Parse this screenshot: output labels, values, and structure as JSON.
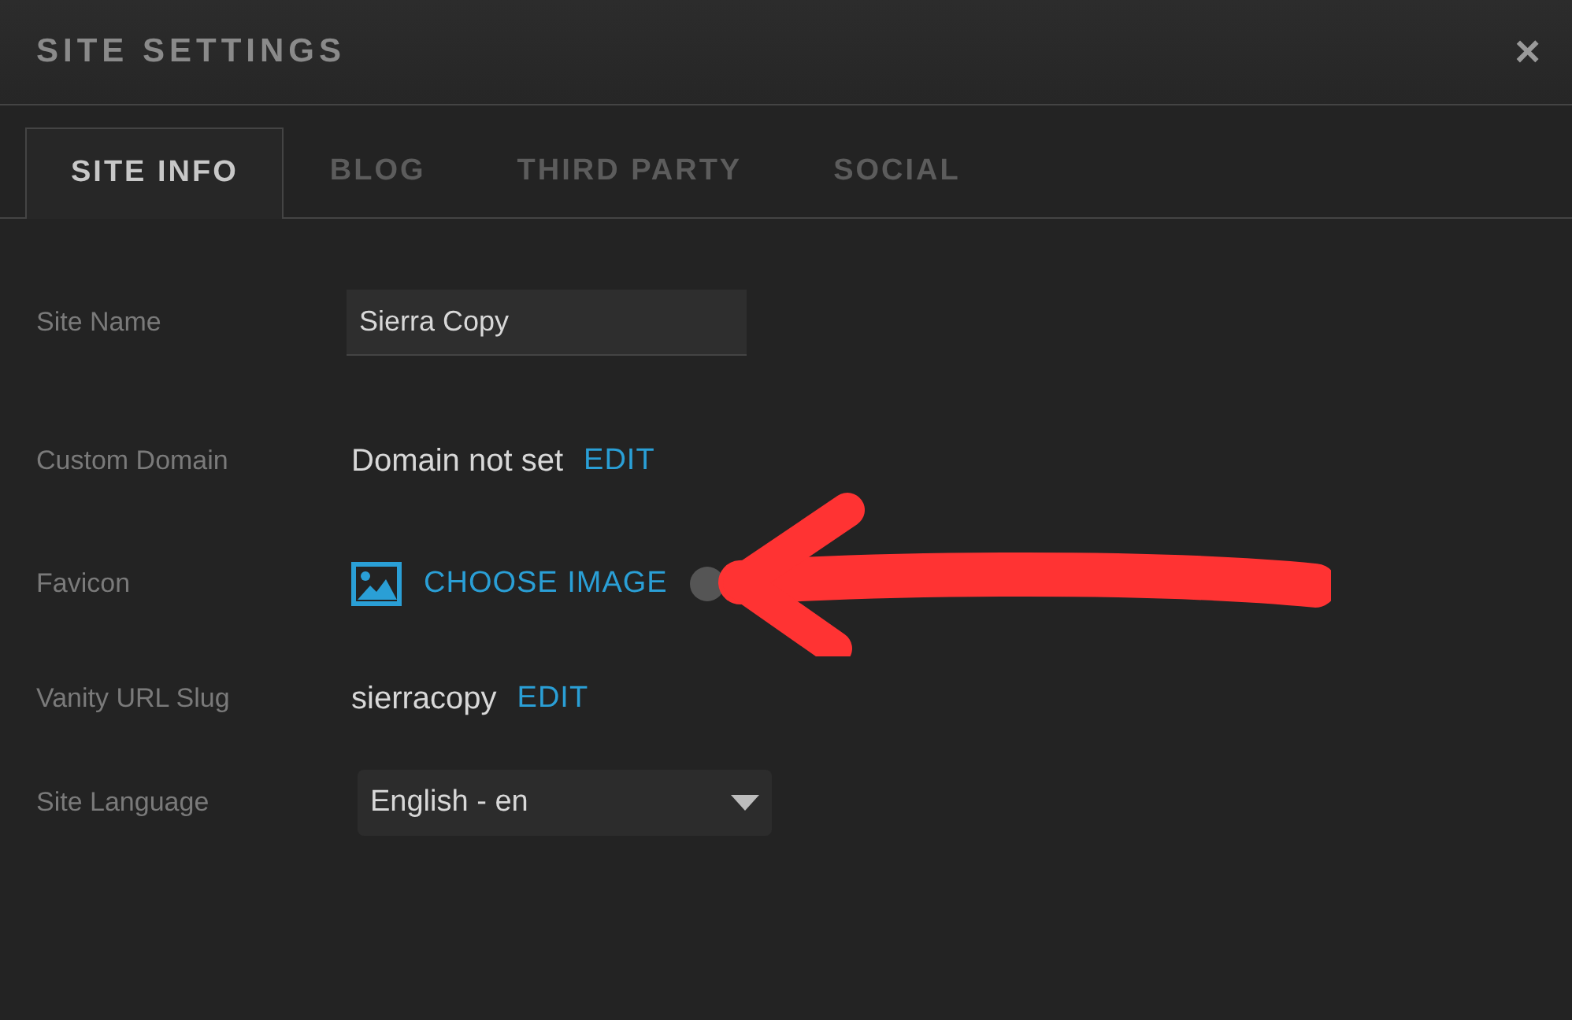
{
  "window": {
    "title": "SITE SETTINGS",
    "close": "×"
  },
  "tabs": [
    {
      "label": "SITE INFO",
      "selected": true
    },
    {
      "label": "BLOG",
      "selected": false
    },
    {
      "label": "THIRD PARTY",
      "selected": false
    },
    {
      "label": "SOCIAL",
      "selected": false
    }
  ],
  "fields": [
    {
      "kind": "input",
      "label": "Site Name",
      "value": "Sierra Copy"
    },
    {
      "kind": "text_edit",
      "label": "Custom Domain",
      "value": "Domain not set",
      "action": "EDIT"
    },
    {
      "kind": "image",
      "label": "Favicon",
      "action": "CHOOSE IMAGE"
    },
    {
      "kind": "text_edit",
      "label": "Vanity URL Slug",
      "value": "sierracopy",
      "action": "EDIT"
    },
    {
      "kind": "select",
      "label": "Site Language",
      "value": "English - en"
    }
  ],
  "annotation": {
    "kind": "arrow"
  }
}
